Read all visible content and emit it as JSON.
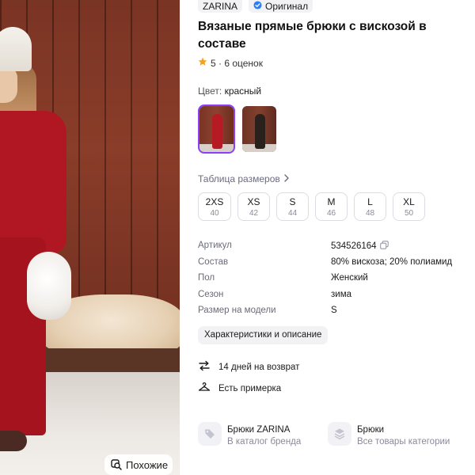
{
  "photo": {
    "similar_button": "Похожие",
    "similar_icon": "search-similar-icon"
  },
  "brand": {
    "name": "ZARINA",
    "original_label": "Оригинал",
    "verified_icon": "verified-check-icon",
    "verified_color": "#2f7df6"
  },
  "product": {
    "title": "Вязаные прямые брюки с вискозой в составе",
    "rating_value": "5",
    "rating_text": "5 · 6 оценок",
    "star_color": "#f5a21b"
  },
  "color": {
    "label": "Цвет:",
    "value": "красный",
    "selected_border": "#8a3ffc"
  },
  "size_table_link": "Таблица размеров",
  "sizes": [
    {
      "size": "2XS",
      "ru": "40"
    },
    {
      "size": "XS",
      "ru": "42"
    },
    {
      "size": "S",
      "ru": "44"
    },
    {
      "size": "M",
      "ru": "46"
    },
    {
      "size": "L",
      "ru": "48"
    },
    {
      "size": "XL",
      "ru": "50"
    }
  ],
  "specs": [
    {
      "key": "Артикул",
      "value": "534526164"
    },
    {
      "key": "Состав",
      "value": "80% вискоза; 20% полиамид"
    },
    {
      "key": "Пол",
      "value": "Женский"
    },
    {
      "key": "Сезон",
      "value": "зима"
    },
    {
      "key": "Размер на модели",
      "value": "S"
    }
  ],
  "characteristics_button": "Характеристики и описание",
  "features": {
    "return": "14 дней на возврат",
    "fitting": "Есть примерка"
  },
  "cards": [
    {
      "title": "Брюки ZARINA",
      "subtitle": "В каталог бренда",
      "icon": "tag-icon"
    },
    {
      "title": "Брюки",
      "subtitle": "Все товары категории",
      "icon": "layers-icon"
    }
  ]
}
